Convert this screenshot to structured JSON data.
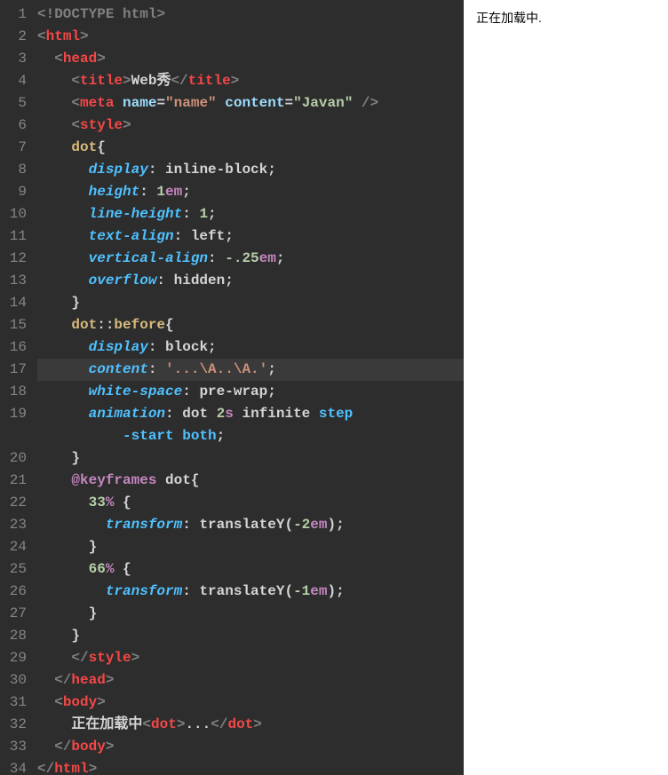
{
  "editor": {
    "highlighted_line": 17,
    "lines": [
      {
        "n": 1,
        "tokens": [
          {
            "t": "<!",
            "c": "c-bracket"
          },
          {
            "t": "DOCTYPE",
            "c": "c-doctype"
          },
          {
            "t": " ",
            "c": "c-bracket"
          },
          {
            "t": "html",
            "c": "c-doctype"
          },
          {
            "t": ">",
            "c": "c-bracket"
          }
        ]
      },
      {
        "n": 2,
        "tokens": [
          {
            "t": "<",
            "c": "c-bracket"
          },
          {
            "t": "html",
            "c": "c-tag"
          },
          {
            "t": ">",
            "c": "c-bracket"
          }
        ]
      },
      {
        "n": 3,
        "indent": 1,
        "tokens": [
          {
            "t": "<",
            "c": "c-bracket"
          },
          {
            "t": "head",
            "c": "c-tag"
          },
          {
            "t": ">",
            "c": "c-bracket"
          }
        ]
      },
      {
        "n": 4,
        "indent": 2,
        "tokens": [
          {
            "t": "<",
            "c": "c-bracket"
          },
          {
            "t": "title",
            "c": "c-tag"
          },
          {
            "t": ">",
            "c": "c-bracket"
          },
          {
            "t": "Web秀",
            "c": "c-text"
          },
          {
            "t": "</",
            "c": "c-bracket"
          },
          {
            "t": "title",
            "c": "c-tag"
          },
          {
            "t": ">",
            "c": "c-bracket"
          }
        ]
      },
      {
        "n": 5,
        "indent": 2,
        "tokens": [
          {
            "t": "<",
            "c": "c-bracket"
          },
          {
            "t": "meta",
            "c": "c-tag"
          },
          {
            "t": " ",
            "c": "c-text"
          },
          {
            "t": "name",
            "c": "c-attr-name"
          },
          {
            "t": "=",
            "c": "c-text"
          },
          {
            "t": "\"name\"",
            "c": "c-attr-value"
          },
          {
            "t": " ",
            "c": "c-text"
          },
          {
            "t": "content",
            "c": "c-attr-name"
          },
          {
            "t": "=",
            "c": "c-text"
          },
          {
            "t": "\"Javan\"",
            "c": "c-attr-value-alt"
          },
          {
            "t": " />",
            "c": "c-bracket"
          }
        ]
      },
      {
        "n": 6,
        "indent": 2,
        "tokens": [
          {
            "t": "<",
            "c": "c-bracket"
          },
          {
            "t": "style",
            "c": "c-tag"
          },
          {
            "t": ">",
            "c": "c-bracket"
          }
        ]
      },
      {
        "n": 7,
        "indent": 2,
        "tokens": [
          {
            "t": "dot",
            "c": "c-selector"
          },
          {
            "t": "{",
            "c": "c-brace"
          }
        ]
      },
      {
        "n": 8,
        "indent": 3,
        "tokens": [
          {
            "t": "display",
            "c": "c-prop"
          },
          {
            "t": ": ",
            "c": "c-colon"
          },
          {
            "t": "inline-block",
            "c": "c-value"
          },
          {
            "t": ";",
            "c": "c-value"
          }
        ]
      },
      {
        "n": 9,
        "indent": 3,
        "tokens": [
          {
            "t": "height",
            "c": "c-prop"
          },
          {
            "t": ": ",
            "c": "c-colon"
          },
          {
            "t": "1",
            "c": "c-number"
          },
          {
            "t": "em",
            "c": "c-unit"
          },
          {
            "t": ";",
            "c": "c-value"
          }
        ]
      },
      {
        "n": 10,
        "indent": 3,
        "tokens": [
          {
            "t": "line-height",
            "c": "c-prop"
          },
          {
            "t": ": ",
            "c": "c-colon"
          },
          {
            "t": "1",
            "c": "c-number"
          },
          {
            "t": ";",
            "c": "c-value"
          }
        ]
      },
      {
        "n": 11,
        "indent": 3,
        "tokens": [
          {
            "t": "text-align",
            "c": "c-prop"
          },
          {
            "t": ": ",
            "c": "c-colon"
          },
          {
            "t": "left",
            "c": "c-value"
          },
          {
            "t": ";",
            "c": "c-value"
          }
        ]
      },
      {
        "n": 12,
        "indent": 3,
        "tokens": [
          {
            "t": "vertical-align",
            "c": "c-prop"
          },
          {
            "t": ": ",
            "c": "c-colon"
          },
          {
            "t": "-.25",
            "c": "c-number"
          },
          {
            "t": "em",
            "c": "c-unit"
          },
          {
            "t": ";",
            "c": "c-value"
          }
        ]
      },
      {
        "n": 13,
        "indent": 3,
        "tokens": [
          {
            "t": "overflow",
            "c": "c-prop"
          },
          {
            "t": ": ",
            "c": "c-colon"
          },
          {
            "t": "hidden",
            "c": "c-value"
          },
          {
            "t": ";",
            "c": "c-value"
          }
        ]
      },
      {
        "n": 14,
        "indent": 2,
        "tokens": [
          {
            "t": "}",
            "c": "c-brace"
          }
        ]
      },
      {
        "n": 15,
        "indent": 2,
        "tokens": [
          {
            "t": "dot",
            "c": "c-selector"
          },
          {
            "t": "::",
            "c": "c-colon"
          },
          {
            "t": "before",
            "c": "c-pseudo"
          },
          {
            "t": "{",
            "c": "c-brace"
          }
        ]
      },
      {
        "n": 16,
        "indent": 3,
        "tokens": [
          {
            "t": "display",
            "c": "c-prop"
          },
          {
            "t": ": ",
            "c": "c-colon"
          },
          {
            "t": "block",
            "c": "c-value"
          },
          {
            "t": ";",
            "c": "c-value"
          }
        ]
      },
      {
        "n": 17,
        "indent": 3,
        "tokens": [
          {
            "t": "content",
            "c": "c-prop"
          },
          {
            "t": ": ",
            "c": "c-colon"
          },
          {
            "t": "'...\\A..\\A.'",
            "c": "c-string"
          },
          {
            "t": ";",
            "c": "c-value"
          }
        ]
      },
      {
        "n": 18,
        "indent": 3,
        "tokens": [
          {
            "t": "white-space",
            "c": "c-prop"
          },
          {
            "t": ": ",
            "c": "c-colon"
          },
          {
            "t": "pre-wrap",
            "c": "c-value"
          },
          {
            "t": ";",
            "c": "c-value"
          }
        ]
      },
      {
        "n": 19,
        "indent": 3,
        "tokens": [
          {
            "t": "animation",
            "c": "c-prop"
          },
          {
            "t": ": ",
            "c": "c-colon"
          },
          {
            "t": "dot ",
            "c": "c-value"
          },
          {
            "t": "2",
            "c": "c-number"
          },
          {
            "t": "s",
            "c": "c-unit"
          },
          {
            "t": " infinite ",
            "c": "c-value"
          },
          {
            "t": "step",
            "c": "c-stepkw"
          }
        ]
      },
      {
        "n": "19b",
        "indent": 5,
        "tokens": [
          {
            "t": "-start",
            "c": "c-stepkw"
          },
          {
            "t": " ",
            "c": "c-value"
          },
          {
            "t": "both",
            "c": "c-stepkw"
          },
          {
            "t": ";",
            "c": "c-value"
          }
        ]
      },
      {
        "n": 20,
        "indent": 2,
        "tokens": [
          {
            "t": "}",
            "c": "c-brace"
          }
        ]
      },
      {
        "n": 21,
        "indent": 2,
        "tokens": [
          {
            "t": "@",
            "c": "c-atkw"
          },
          {
            "t": "keyframes",
            "c": "c-atkw"
          },
          {
            "t": " dot",
            "c": "c-value"
          },
          {
            "t": "{",
            "c": "c-brace"
          }
        ]
      },
      {
        "n": 22,
        "indent": 3,
        "tokens": [
          {
            "t": "33",
            "c": "c-number"
          },
          {
            "t": "%",
            "c": "c-perc"
          },
          {
            "t": " {",
            "c": "c-brace"
          }
        ]
      },
      {
        "n": 23,
        "indent": 4,
        "tokens": [
          {
            "t": "transform",
            "c": "c-prop"
          },
          {
            "t": ": ",
            "c": "c-colon"
          },
          {
            "t": "translateY(",
            "c": "c-func"
          },
          {
            "t": "-2",
            "c": "c-number"
          },
          {
            "t": "em",
            "c": "c-unit"
          },
          {
            "t": ");",
            "c": "c-value"
          }
        ]
      },
      {
        "n": 24,
        "indent": 3,
        "tokens": [
          {
            "t": "}",
            "c": "c-brace"
          }
        ]
      },
      {
        "n": 25,
        "indent": 3,
        "tokens": [
          {
            "t": "66",
            "c": "c-number"
          },
          {
            "t": "%",
            "c": "c-perc"
          },
          {
            "t": " {",
            "c": "c-brace"
          }
        ]
      },
      {
        "n": 26,
        "indent": 4,
        "tokens": [
          {
            "t": "transform",
            "c": "c-prop"
          },
          {
            "t": ": ",
            "c": "c-colon"
          },
          {
            "t": "translateY(",
            "c": "c-func"
          },
          {
            "t": "-1",
            "c": "c-number"
          },
          {
            "t": "em",
            "c": "c-unit"
          },
          {
            "t": ");",
            "c": "c-value"
          }
        ]
      },
      {
        "n": 27,
        "indent": 3,
        "tokens": [
          {
            "t": "}",
            "c": "c-brace"
          }
        ]
      },
      {
        "n": 28,
        "indent": 2,
        "tokens": [
          {
            "t": "}",
            "c": "c-brace"
          }
        ]
      },
      {
        "n": 29,
        "indent": 2,
        "tokens": [
          {
            "t": "</",
            "c": "c-bracket"
          },
          {
            "t": "style",
            "c": "c-tag"
          },
          {
            "t": ">",
            "c": "c-bracket"
          }
        ]
      },
      {
        "n": 30,
        "indent": 1,
        "tokens": [
          {
            "t": "</",
            "c": "c-bracket"
          },
          {
            "t": "head",
            "c": "c-tag"
          },
          {
            "t": ">",
            "c": "c-bracket"
          }
        ]
      },
      {
        "n": 31,
        "indent": 1,
        "tokens": [
          {
            "t": "<",
            "c": "c-bracket"
          },
          {
            "t": "body",
            "c": "c-tag"
          },
          {
            "t": ">",
            "c": "c-bracket"
          }
        ]
      },
      {
        "n": 32,
        "indent": 2,
        "tokens": [
          {
            "t": "正在加载中",
            "c": "c-text"
          },
          {
            "t": "<",
            "c": "c-bracket"
          },
          {
            "t": "dot",
            "c": "c-tag"
          },
          {
            "t": ">",
            "c": "c-bracket"
          },
          {
            "t": "...",
            "c": "c-text"
          },
          {
            "t": "</",
            "c": "c-bracket"
          },
          {
            "t": "dot",
            "c": "c-tag"
          },
          {
            "t": ">",
            "c": "c-bracket"
          }
        ]
      },
      {
        "n": 33,
        "indent": 1,
        "tokens": [
          {
            "t": "</",
            "c": "c-bracket"
          },
          {
            "t": "body",
            "c": "c-tag"
          },
          {
            "t": ">",
            "c": "c-bracket"
          }
        ]
      },
      {
        "n": 34,
        "tokens": [
          {
            "t": "</",
            "c": "c-bracket"
          },
          {
            "t": "html",
            "c": "c-tag"
          },
          {
            "t": ">",
            "c": "c-bracket"
          }
        ]
      }
    ]
  },
  "preview": {
    "text": "正在加载中."
  }
}
